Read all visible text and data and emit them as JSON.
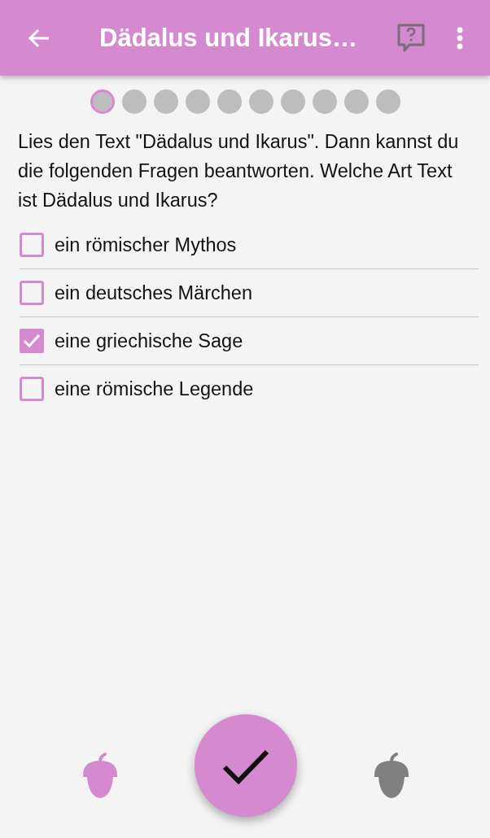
{
  "app_bar": {
    "title": "Dädalus und Ikarus…"
  },
  "progress": [
    {
      "selected": true
    },
    {
      "selected": false
    },
    {
      "selected": false
    },
    {
      "selected": false
    },
    {
      "selected": false
    },
    {
      "selected": false
    },
    {
      "selected": false
    },
    {
      "selected": false
    },
    {
      "selected": false
    },
    {
      "selected": false
    }
  ],
  "question": "Lies den Text \"Dädalus und Ikarus\". Dann kannst du die folgenden Fragen beantworten. Welche Art Text ist Dädalus und Ikarus?",
  "options": [
    {
      "label": "ein römischer Mythos",
      "checked": false
    },
    {
      "label": "ein deutsches Märchen",
      "checked": false
    },
    {
      "label": "eine griechische Sage",
      "checked": true
    },
    {
      "label": "eine römische Legende",
      "checked": false
    }
  ],
  "acorns": [
    {
      "active": true
    },
    {
      "active": false
    }
  ]
}
